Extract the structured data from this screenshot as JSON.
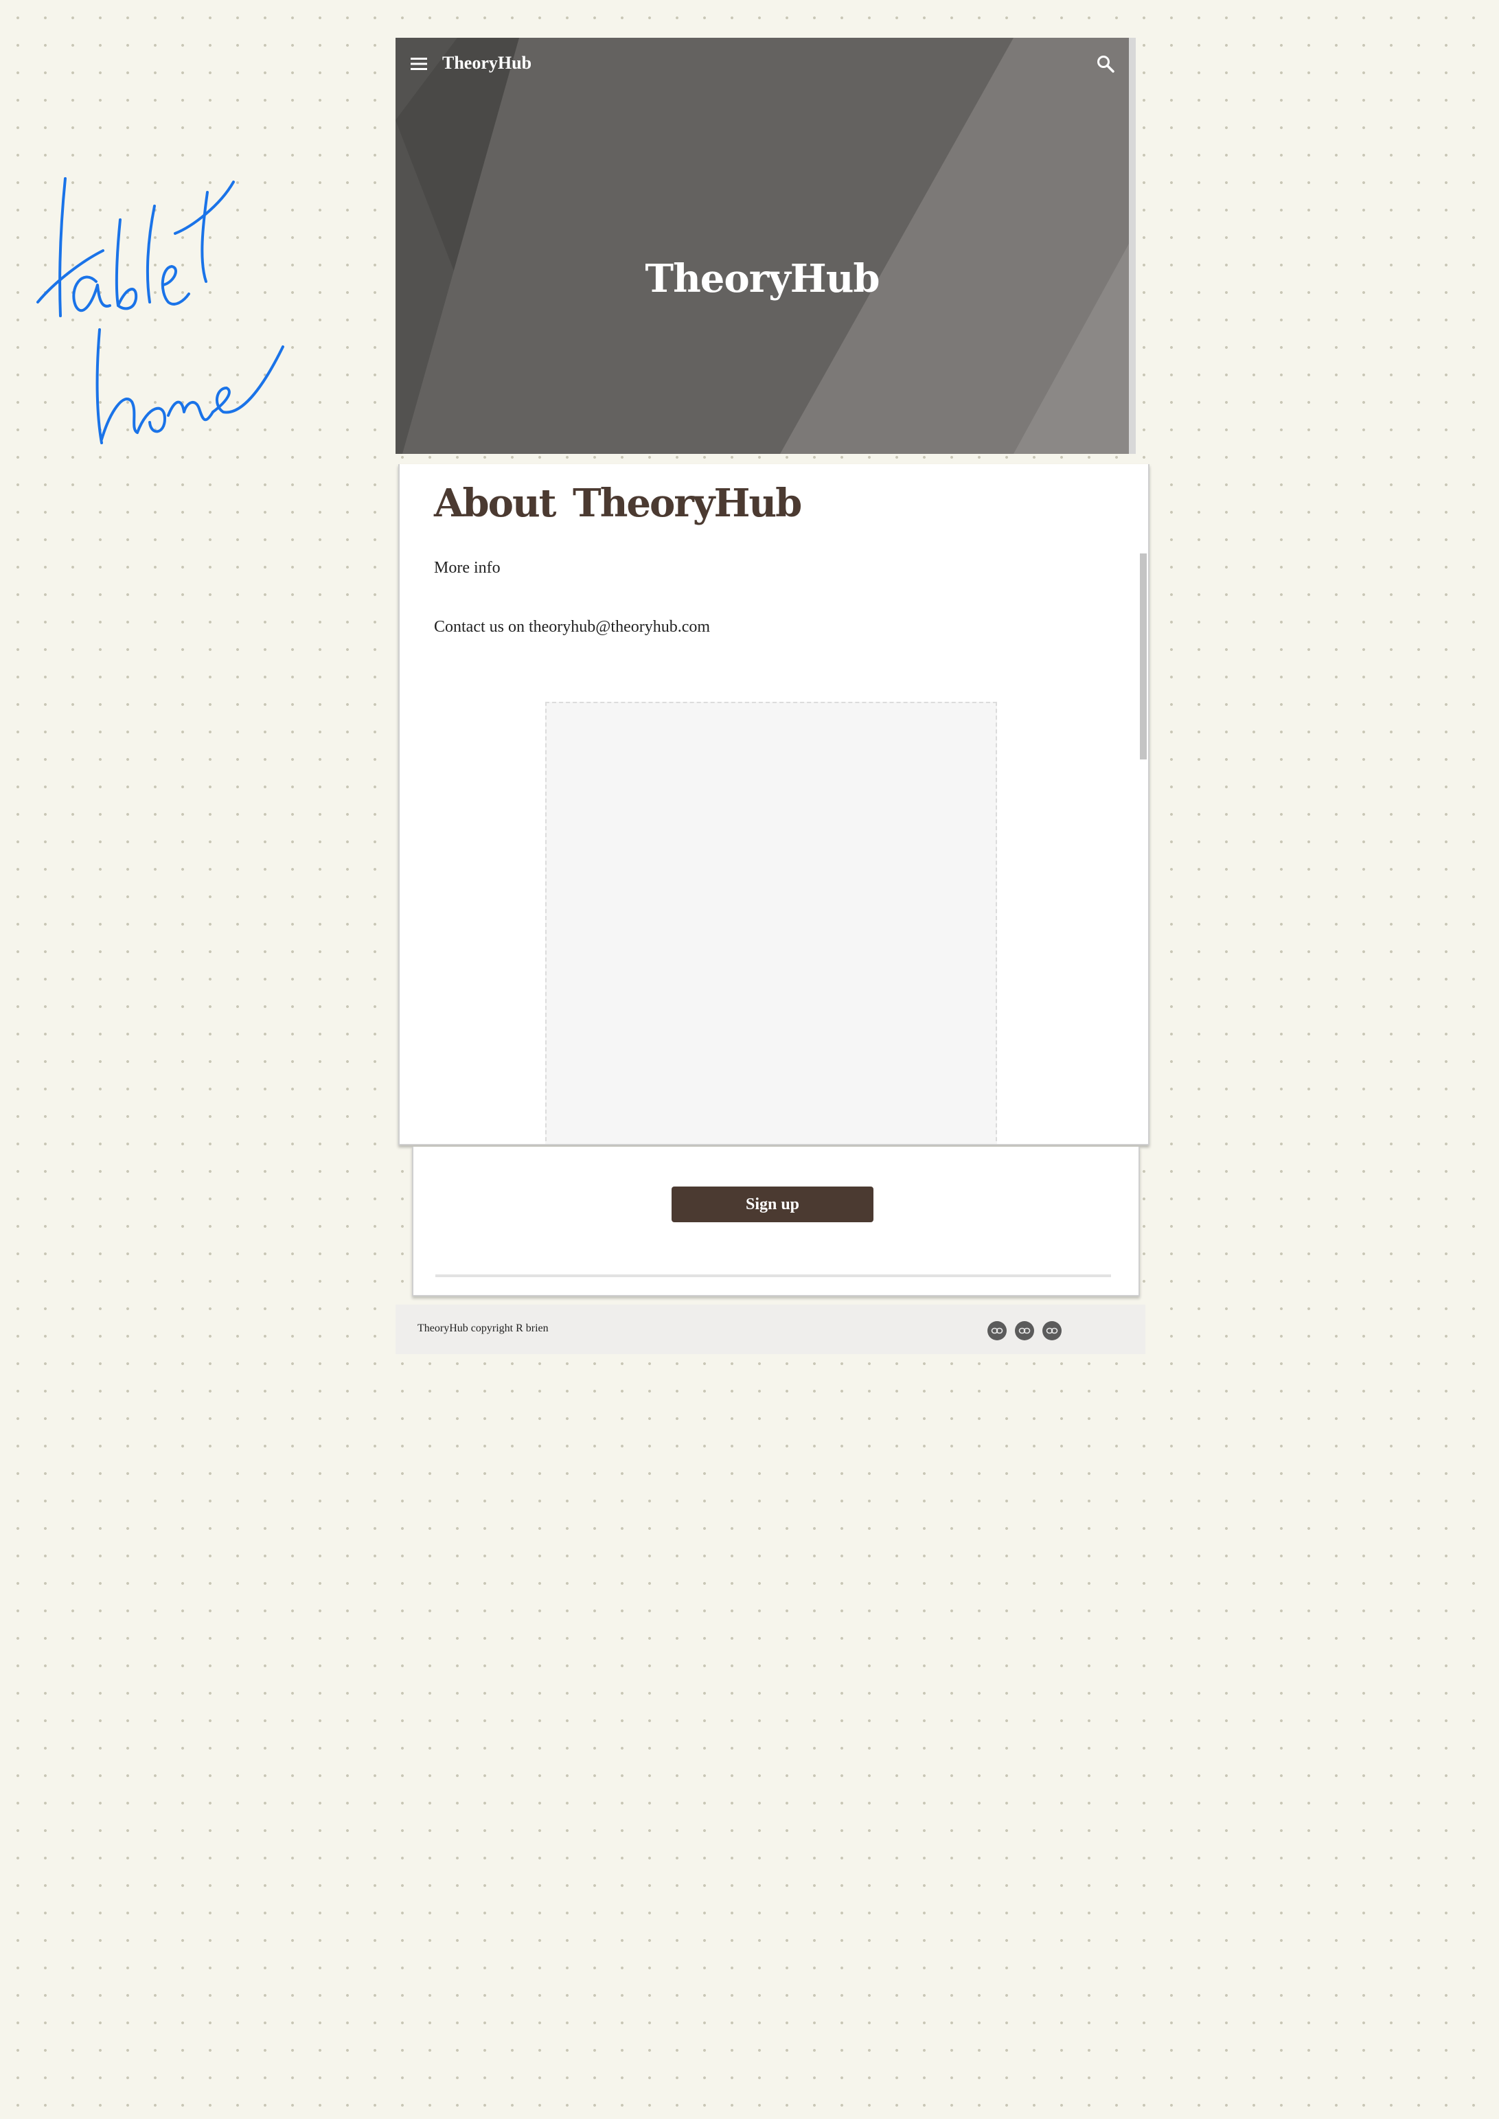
{
  "annotation": {
    "line1": "tablet",
    "line2": "home"
  },
  "header": {
    "menu_icon": "menu-icon",
    "brand": "TheoryHub",
    "search_icon": "search-icon"
  },
  "hero": {
    "title": "TheoryHub"
  },
  "content": {
    "heading": "About  TheoryHub",
    "more_info": "More info",
    "contact": "Contact us on theoryhub@theoryhub.com"
  },
  "signup": {
    "button_label": "Sign up"
  },
  "footer": {
    "copyright": "TheoryHub copyright R brien",
    "social_icons": [
      "link-icon",
      "link-icon",
      "link-icon"
    ]
  },
  "colors": {
    "background": "#f6f5ec",
    "accent": "#4b3a31",
    "hero": "#5f5d5b",
    "annotation_ink": "#1a73e8",
    "footer": "#efeeec"
  }
}
